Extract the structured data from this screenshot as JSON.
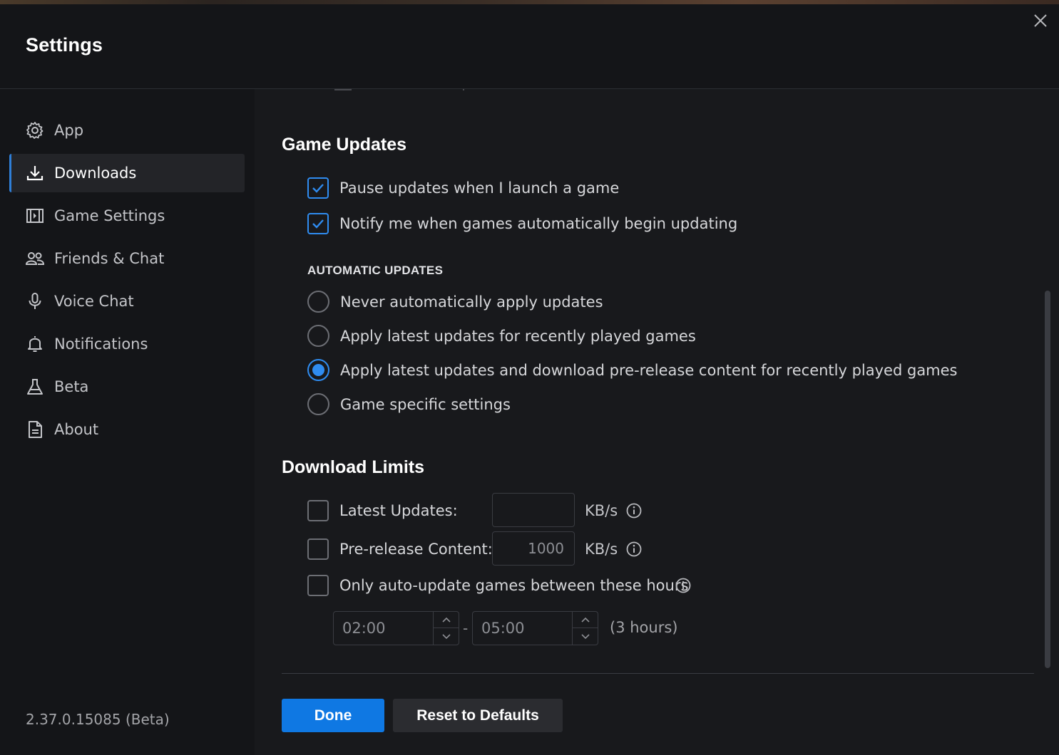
{
  "window": {
    "title": "Settings"
  },
  "sidebar": {
    "items": [
      {
        "label": "App",
        "icon": "gear-icon",
        "active": false
      },
      {
        "label": "Downloads",
        "icon": "download-icon",
        "active": true
      },
      {
        "label": "Game Settings",
        "icon": "game-settings-icon",
        "active": false
      },
      {
        "label": "Friends & Chat",
        "icon": "friends-icon",
        "active": false
      },
      {
        "label": "Voice Chat",
        "icon": "microphone-icon",
        "active": false
      },
      {
        "label": "Notifications",
        "icon": "bell-icon",
        "active": false
      },
      {
        "label": "Beta",
        "icon": "flask-icon",
        "active": false
      },
      {
        "label": "About",
        "icon": "document-icon",
        "active": false
      }
    ],
    "version": "2.37.0.15085 (Beta)"
  },
  "game_updates": {
    "title": "Game Updates",
    "checkboxes": [
      {
        "label": "Pause updates when I launch a game",
        "checked": true
      },
      {
        "label": "Notify me when games automatically begin updating",
        "checked": true
      }
    ],
    "automatic_updates": {
      "heading": "AUTOMATIC UPDATES",
      "options": [
        {
          "label": "Never automatically apply updates",
          "selected": false
        },
        {
          "label": "Apply latest updates for recently played games",
          "selected": false
        },
        {
          "label": "Apply latest updates and download pre-release content for recently played games",
          "selected": true
        },
        {
          "label": "Game specific settings",
          "selected": false
        }
      ]
    }
  },
  "download_limits": {
    "title": "Download Limits",
    "latest_updates": {
      "label": "Latest Updates:",
      "checked": false,
      "value": "",
      "unit": "KB/s"
    },
    "prerelease": {
      "label": "Pre-release Content:",
      "checked": false,
      "value": "1000",
      "unit": "KB/s"
    },
    "hours": {
      "label": "Only auto-update games between these hours",
      "checked": false,
      "start": "02:00",
      "separator": "-",
      "end": "05:00",
      "duration": "(3 hours)"
    }
  },
  "actions": {
    "done": "Done",
    "reset": "Reset to Defaults"
  },
  "colors": {
    "accent": "#2f8cf0",
    "done_button": "#0f78e3",
    "background": "#18191c",
    "sidebar": "#141518"
  }
}
